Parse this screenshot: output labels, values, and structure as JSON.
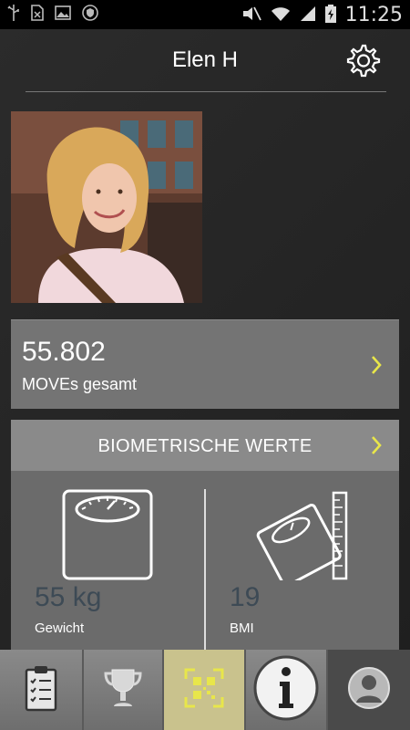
{
  "status_bar": {
    "time": "11:25",
    "left_icons": [
      "usb-icon",
      "sim-icon",
      "image-icon",
      "shield-icon"
    ],
    "right_icons": [
      "mute-icon",
      "wifi-icon",
      "signal-icon",
      "battery-icon"
    ]
  },
  "header": {
    "title": "Elen H",
    "settings_icon": "gear-icon"
  },
  "profile": {
    "avatar": "profile-photo"
  },
  "moves": {
    "value": "55.802",
    "label": "MOVEs gesamt"
  },
  "biometrics": {
    "title": "BIOMETRISCHE WERTE",
    "weight": {
      "value": "55 kg",
      "label": "Gewicht",
      "icon": "scale-icon"
    },
    "bmi": {
      "value": "19",
      "label": "BMI",
      "icon": "bmi-scale-icon"
    }
  },
  "bottom_nav": {
    "items": [
      {
        "icon": "checklist-icon"
      },
      {
        "icon": "trophy-icon"
      },
      {
        "icon": "qr-code-icon",
        "active": true
      },
      {
        "icon": "info-icon"
      },
      {
        "icon": "profile-icon"
      }
    ]
  },
  "colors": {
    "accent": "#d4d36a",
    "card": "#747474",
    "background": "#262626",
    "value_text": "#3d4a55"
  }
}
